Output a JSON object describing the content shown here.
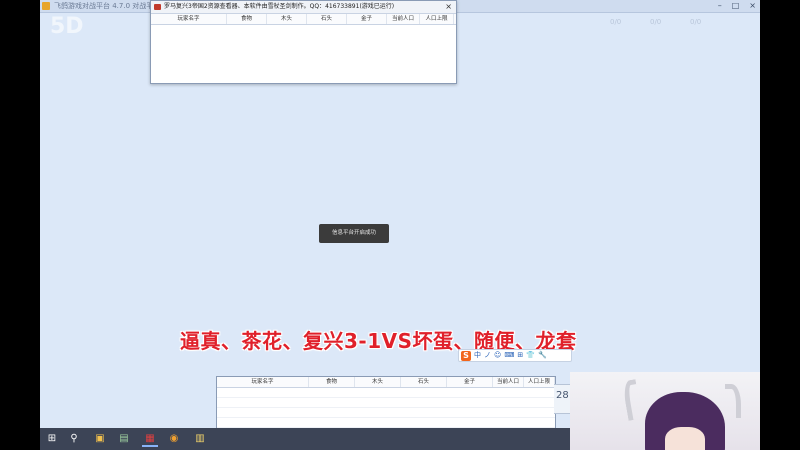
{
  "app": {
    "title": "飞鸽游戏对战平台 4.7.0  对战平台",
    "controls": {
      "minimize": "–",
      "maximize": "□",
      "close": "×"
    },
    "bg_logo": "5D",
    "bg_stats": [
      "0/0",
      "0/0",
      "0/0"
    ]
  },
  "stats_window": {
    "title": "罗马复兴3帝国2资源查看器、本软件由雪杖圣剑制作。QQ：416733891(游戏已运行)",
    "close_label": "×",
    "columns": [
      "玩家名字",
      "食物",
      "木头",
      "石头",
      "金子",
      "当前人口",
      "人口上限"
    ]
  },
  "toast": {
    "text": "信息平台开启成功"
  },
  "caption": {
    "text": "逼真、茶花、复兴3-1VS坏蛋、随便、龙套"
  },
  "ime": {
    "logo": "S",
    "items": [
      "中",
      "ノ",
      "☺",
      "⌨",
      "⊞",
      "👕",
      "🔧"
    ]
  },
  "stats_window2": {
    "columns": [
      "玩家名字",
      "食物",
      "木头",
      "石头",
      "金子",
      "当前人口",
      "人口上限"
    ]
  },
  "peek": {
    "text": "28"
  },
  "taskbar": {
    "icons": [
      {
        "name": "start",
        "glyph": "⊞"
      },
      {
        "name": "search",
        "glyph": "⚲"
      },
      {
        "name": "app1",
        "glyph": "▣"
      },
      {
        "name": "app2",
        "glyph": "▤"
      },
      {
        "name": "app3",
        "glyph": "▦"
      },
      {
        "name": "app4",
        "glyph": "◉"
      },
      {
        "name": "app5",
        "glyph": "▥"
      }
    ]
  }
}
